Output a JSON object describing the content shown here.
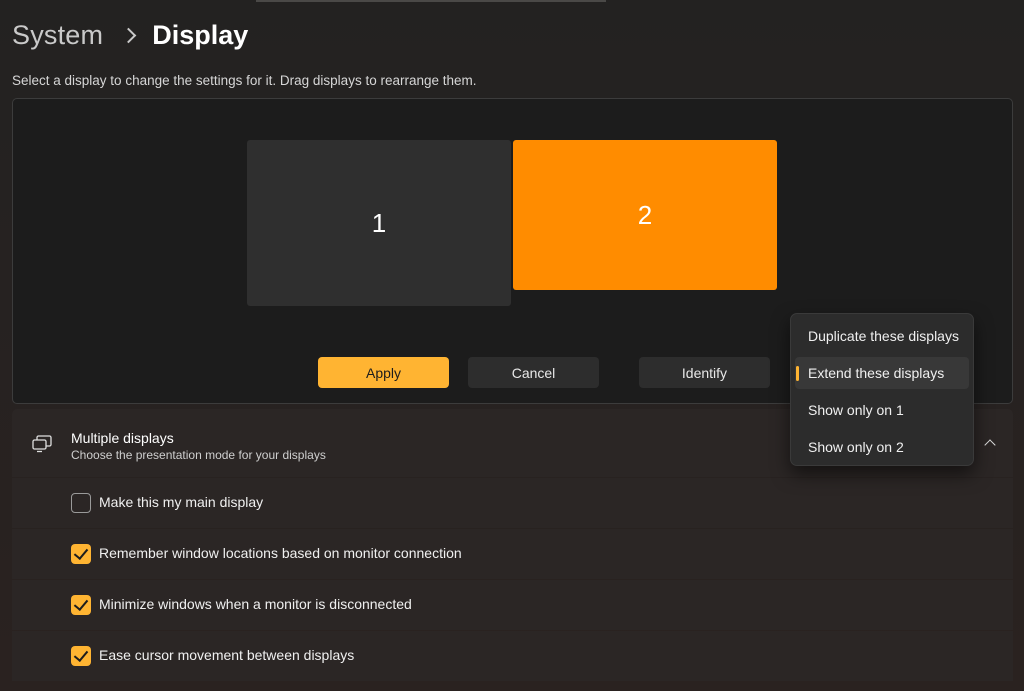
{
  "breadcrumb": {
    "parent": "System",
    "current": "Display"
  },
  "instructions": "Select a display to change the settings for it. Drag displays to rearrange them.",
  "monitors": [
    {
      "label": "1",
      "selected": false,
      "color": "#2f2f2f"
    },
    {
      "label": "2",
      "selected": true,
      "color": "#ff8c00"
    }
  ],
  "buttons": {
    "apply": "Apply",
    "cancel": "Cancel",
    "identify": "Identify"
  },
  "multiple_displays": {
    "icon": "multiple-displays-icon",
    "title": "Multiple displays",
    "subtitle": "Choose the presentation mode for your displays",
    "expanded": true
  },
  "options": [
    {
      "label": "Make this my main display",
      "checked": false
    },
    {
      "label": "Remember window locations based on monitor connection",
      "checked": true
    },
    {
      "label": "Minimize windows when a monitor is disconnected",
      "checked": true
    },
    {
      "label": "Ease cursor movement between displays",
      "checked": true
    }
  ],
  "presentation_menu": {
    "items": [
      {
        "label": "Duplicate these displays",
        "selected": false
      },
      {
        "label": "Extend these displays",
        "selected": true
      },
      {
        "label": "Show only on 1",
        "selected": false
      },
      {
        "label": "Show only on 2",
        "selected": false
      }
    ]
  },
  "colors": {
    "accent": "#ffb432",
    "selected_monitor": "#ff8c00",
    "card_background": "#2b2625",
    "panel_background": "#1c1c1c"
  }
}
